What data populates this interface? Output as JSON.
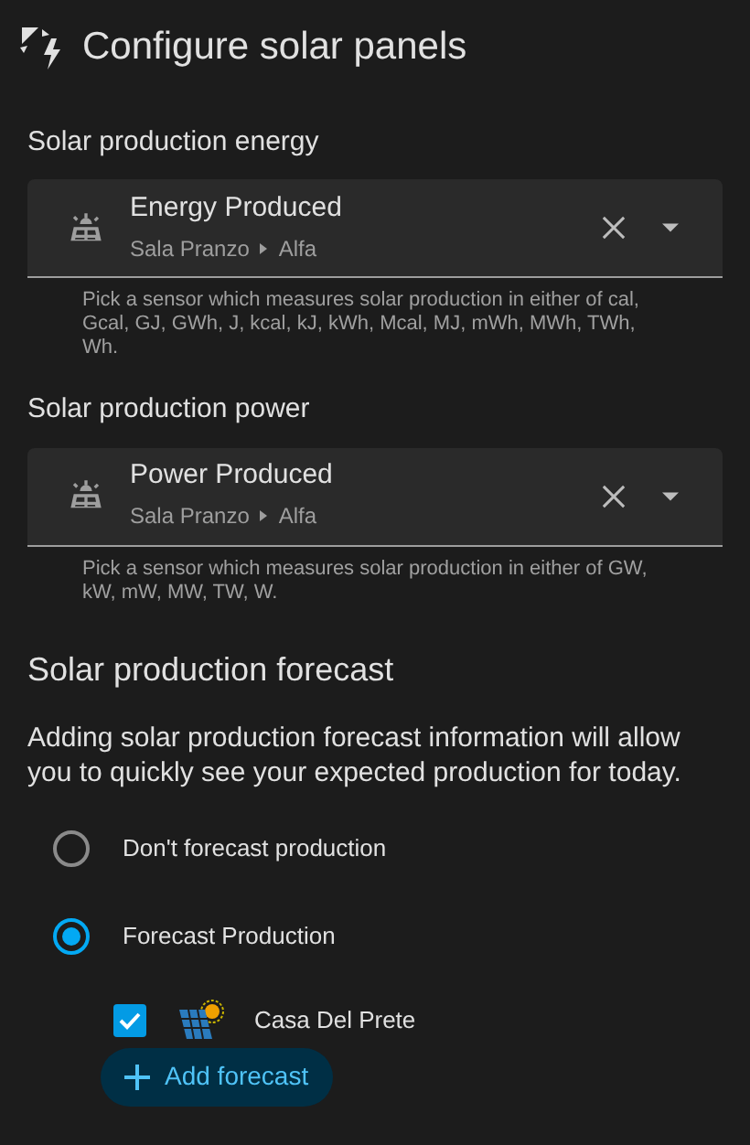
{
  "title": "Configure solar panels",
  "sensors": [
    {
      "label": "Solar production energy",
      "name": "Energy Produced",
      "area": "Sala Pranzo",
      "device": "Alfa",
      "helper": "Pick a sensor which measures solar production in either of cal, Gcal, GJ, GWh, J, kcal, kJ, kWh, Mcal, MJ, mWh, MWh, TWh, Wh."
    },
    {
      "label": "Solar production power",
      "name": "Power Produced",
      "area": "Sala Pranzo",
      "device": "Alfa",
      "helper": "Pick a sensor which measures solar production in either of GW, kW, mW, MW, TW, W."
    }
  ],
  "forecast": {
    "heading": "Solar production forecast",
    "description": "Adding solar production forecast information will allow you to quickly see your expected production for today.",
    "options": [
      {
        "label": "Don't forecast production",
        "selected": false
      },
      {
        "label": "Forecast Production",
        "selected": true
      }
    ],
    "entries": [
      {
        "label": "Casa Del Prete",
        "checked": true
      }
    ],
    "add_button": "Add forecast"
  }
}
